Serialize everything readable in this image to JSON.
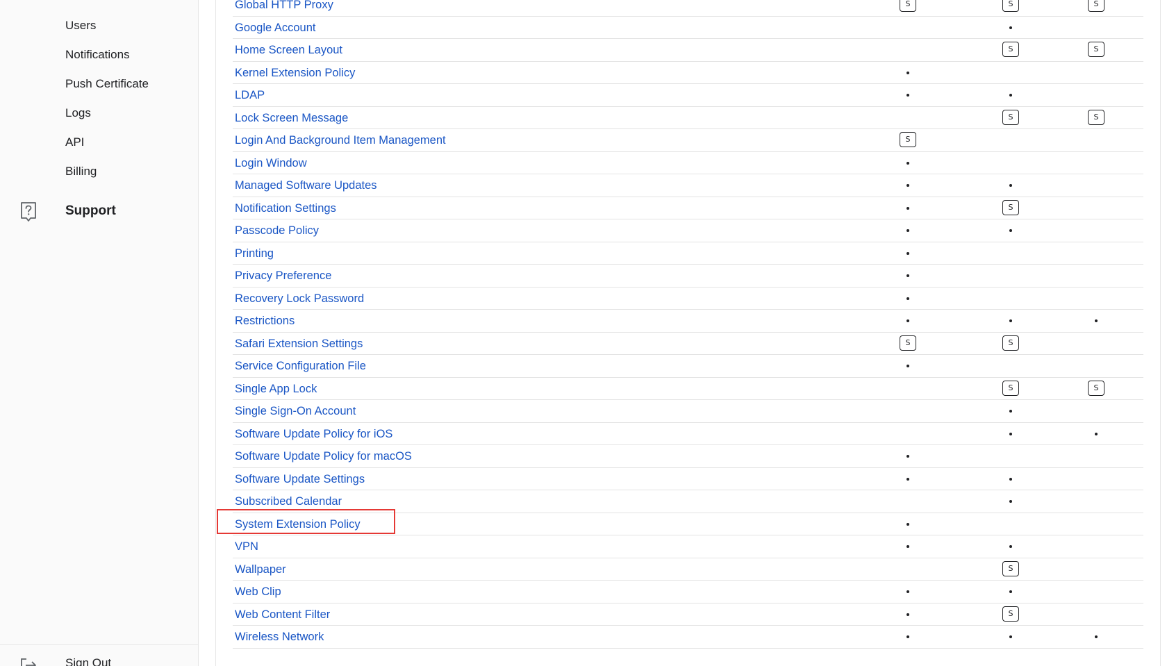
{
  "sidebar": {
    "items": [
      {
        "label": "Users",
        "name": "sidebar-item-users"
      },
      {
        "label": "Notifications",
        "name": "sidebar-item-notifications"
      },
      {
        "label": "Push Certificate",
        "name": "sidebar-item-push-certificate"
      },
      {
        "label": "Logs",
        "name": "sidebar-item-logs"
      },
      {
        "label": "API",
        "name": "sidebar-item-api"
      },
      {
        "label": "Billing",
        "name": "sidebar-item-billing"
      }
    ],
    "support_label": "Support",
    "support_icon": "help-icon",
    "signout_label": "Sign Out",
    "signout_icon": "sign-out-icon"
  },
  "legend": {
    "dot": "•",
    "supervised": "S"
  },
  "profiles": [
    {
      "name": "Global HTTP Proxy",
      "cells": [
        "S",
        "S",
        "S"
      ]
    },
    {
      "name": "Google Account",
      "cells": [
        "",
        "dot",
        ""
      ]
    },
    {
      "name": "Home Screen Layout",
      "cells": [
        "",
        "S",
        "S"
      ]
    },
    {
      "name": "Kernel Extension Policy",
      "cells": [
        "dot",
        "",
        ""
      ]
    },
    {
      "name": "LDAP",
      "cells": [
        "dot",
        "dot",
        ""
      ]
    },
    {
      "name": "Lock Screen Message",
      "cells": [
        "",
        "S",
        "S"
      ]
    },
    {
      "name": "Login And Background Item Management",
      "cells": [
        "S",
        "",
        ""
      ]
    },
    {
      "name": "Login Window",
      "cells": [
        "dot",
        "",
        ""
      ]
    },
    {
      "name": "Managed Software Updates",
      "cells": [
        "dot",
        "dot",
        ""
      ]
    },
    {
      "name": "Notification Settings",
      "cells": [
        "dot",
        "S",
        ""
      ]
    },
    {
      "name": "Passcode Policy",
      "cells": [
        "dot",
        "dot",
        ""
      ]
    },
    {
      "name": "Printing",
      "cells": [
        "dot",
        "",
        ""
      ]
    },
    {
      "name": "Privacy Preference",
      "cells": [
        "dot",
        "",
        ""
      ]
    },
    {
      "name": "Recovery Lock Password",
      "cells": [
        "dot",
        "",
        ""
      ]
    },
    {
      "name": "Restrictions",
      "cells": [
        "dot",
        "dot",
        "dot"
      ]
    },
    {
      "name": "Safari Extension Settings",
      "cells": [
        "S",
        "S",
        ""
      ]
    },
    {
      "name": "Service Configuration File",
      "cells": [
        "dot",
        "",
        ""
      ]
    },
    {
      "name": "Single App Lock",
      "cells": [
        "",
        "S",
        "S"
      ]
    },
    {
      "name": "Single Sign-On Account",
      "cells": [
        "",
        "dot",
        ""
      ]
    },
    {
      "name": "Software Update Policy for iOS",
      "cells": [
        "",
        "dot",
        "dot"
      ]
    },
    {
      "name": "Software Update Policy for macOS",
      "cells": [
        "dot",
        "",
        ""
      ]
    },
    {
      "name": "Software Update Settings",
      "cells": [
        "dot",
        "dot",
        ""
      ]
    },
    {
      "name": "Subscribed Calendar",
      "cells": [
        "",
        "dot",
        ""
      ]
    },
    {
      "name": "System Extension Policy",
      "cells": [
        "dot",
        "",
        ""
      ],
      "highlighted": true
    },
    {
      "name": "VPN",
      "cells": [
        "dot",
        "dot",
        ""
      ]
    },
    {
      "name": "Wallpaper",
      "cells": [
        "",
        "S",
        ""
      ]
    },
    {
      "name": "Web Clip",
      "cells": [
        "dot",
        "dot",
        ""
      ]
    },
    {
      "name": "Web Content Filter",
      "cells": [
        "dot",
        "S",
        ""
      ]
    },
    {
      "name": "Wireless Network",
      "cells": [
        "dot",
        "dot",
        "dot"
      ]
    }
  ],
  "colors": {
    "link": "#1a56c5",
    "highlight": "#e53935",
    "sidebar_bg": "#fafafa"
  }
}
